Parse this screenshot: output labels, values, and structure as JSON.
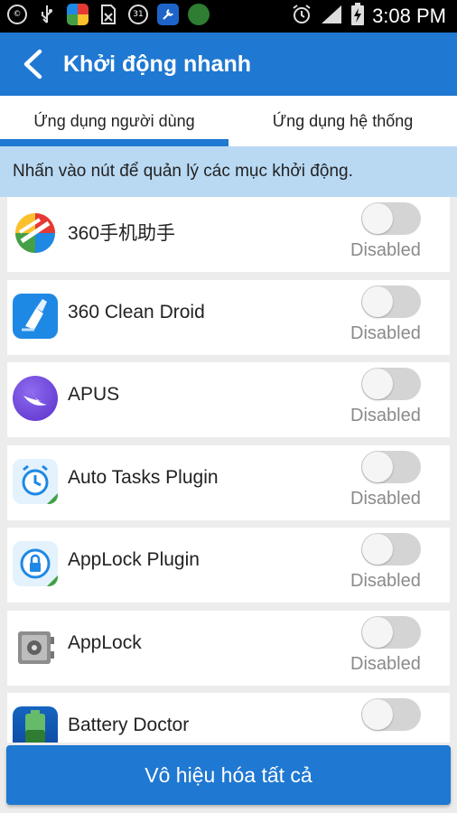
{
  "status_bar": {
    "time": "3:08 PM",
    "calendar_day": "31",
    "left_icons": [
      "copyright-icon",
      "usb-icon",
      "app-360-icon",
      "sim-off-icon",
      "calendar-icon",
      "tools-icon",
      "app-green-icon"
    ],
    "right_icons": [
      "alarm-icon",
      "signal-icon",
      "battery-charging-icon"
    ]
  },
  "app_bar": {
    "title": "Khởi động nhanh"
  },
  "tabs": [
    {
      "label": "Ứng dụng người dùng",
      "active": true
    },
    {
      "label": "Ứng dụng hệ thống",
      "active": false
    }
  ],
  "banner": {
    "text": "Nhấn vào nút để quản lý các mục khởi động."
  },
  "apps": [
    {
      "name": "360手机助手",
      "status": "Disabled",
      "icon": "360-assistant-icon"
    },
    {
      "name": "360 Clean Droid",
      "status": "Disabled",
      "icon": "clean-droid-icon"
    },
    {
      "name": "APUS",
      "status": "Disabled",
      "icon": "apus-icon"
    },
    {
      "name": "Auto Tasks Plugin",
      "status": "Disabled",
      "icon": "auto-tasks-icon"
    },
    {
      "name": "AppLock Plugin",
      "status": "Disabled",
      "icon": "applock-plugin-icon"
    },
    {
      "name": "AppLock",
      "status": "Disabled",
      "icon": "applock-icon"
    },
    {
      "name": "Battery Doctor",
      "status": "",
      "icon": "battery-doctor-icon"
    }
  ],
  "colors": {
    "primary": "#1f78d1",
    "banner_bg": "#b9d9f3",
    "toggle_off": "#d4d4d4",
    "status_text": "#8a8a8a"
  },
  "bottom_button": {
    "label": "Vô hiệu hóa tất cả"
  }
}
